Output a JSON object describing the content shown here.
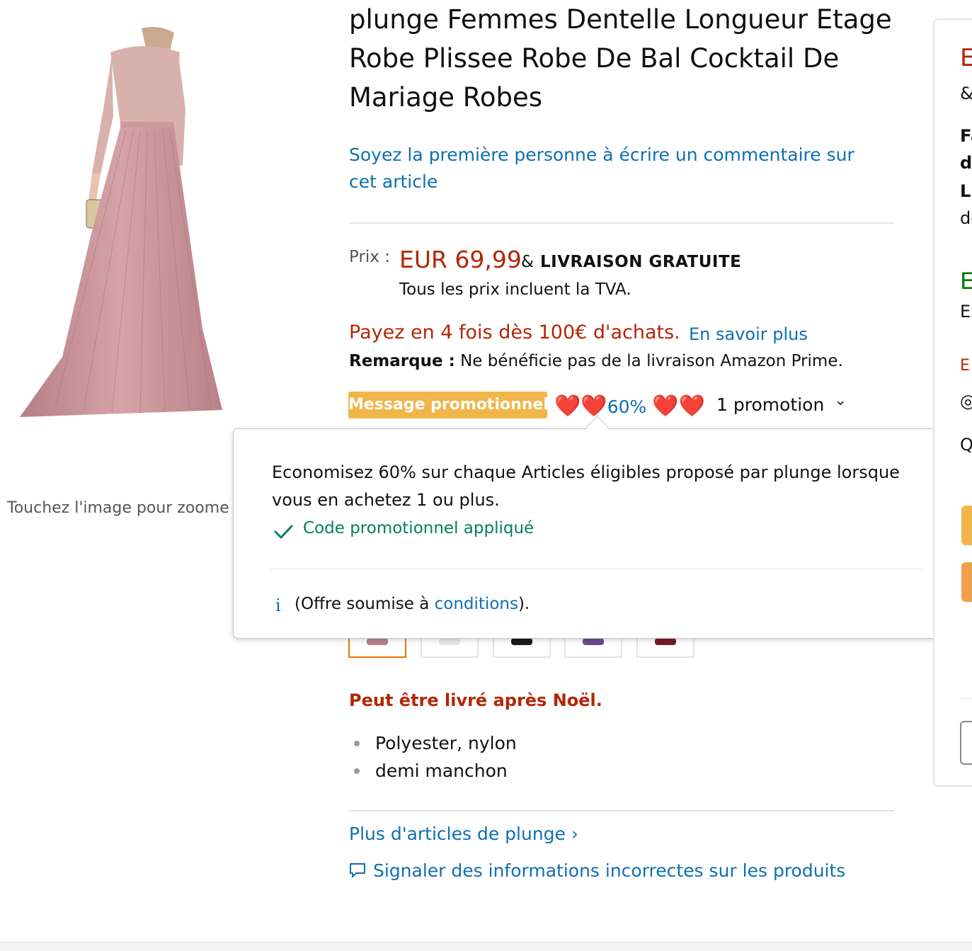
{
  "product": {
    "title": "plunge Femmes Dentelle Longueur Etage Robe Plissee Robe De Bal Cocktail De Mariage Robes",
    "review_cta": "Soyez la première personne à écrire un commentaire sur cet article",
    "image_hint": "Touchez l'image pour zoome",
    "image_icon": "dress-photo"
  },
  "price": {
    "label": "Prix :",
    "value": "EUR 69,99",
    "amp": "&",
    "shipping": "LIVRAISON GRATUITE",
    "vat_note": "Tous les prix incluent la TVA.",
    "installments": "Payez en 4 fois dès 100€ d'achats.",
    "learn_more": "En savoir plus",
    "remark_label": "Remarque :",
    "remark_text": "Ne bénéficie pas de la livraison Amazon Prime."
  },
  "promo": {
    "badge": "Message promotionnel",
    "hearts_left": "❤️❤️",
    "percent": "60%",
    "hearts_right": "❤️❤️",
    "count": "1 promotion",
    "chevron": "⌄"
  },
  "popover": {
    "description": "Economisez 60% sur chaque Articles éligibles proposé par plunge lorsque vous en achetez 1 ou plus.",
    "applied": "Code promotionnel appliqué",
    "info_glyph": "i",
    "conditions_prefix": "(Offre soumise à ",
    "conditions_link": "conditions",
    "conditions_suffix": ")."
  },
  "swatches": [
    {
      "name": "pink",
      "color": "#b9838a",
      "selected": true
    },
    {
      "name": "white",
      "color": "#e8e8e8",
      "selected": false
    },
    {
      "name": "black",
      "color": "#1a1a1a",
      "selected": false
    },
    {
      "name": "purple",
      "color": "#6b4a8f",
      "selected": false
    },
    {
      "name": "red",
      "color": "#7a1a24",
      "selected": false
    }
  ],
  "delivery_note": "Peut être livré après Noël.",
  "features": [
    "Polyester, nylon",
    "demi manchon"
  ],
  "links": {
    "more_from_brand": "Plus d'articles de plunge ›",
    "report": "Signaler des informations incorrectes sur les produits"
  },
  "buybox": {
    "price_initial": "E",
    "amp": "&",
    "line1": "Fa",
    "line2": "d",
    "line3": "Li",
    "line4": "de",
    "stock_initial": "E",
    "stock_line": "Ex",
    "eur_initial": "E",
    "q_initial": "Q"
  },
  "colors": {
    "link": "#0f6fb0",
    "price": "#b12704",
    "promo_badge": "#f0b64a",
    "success": "#067d62",
    "stock_green": "#007600"
  }
}
